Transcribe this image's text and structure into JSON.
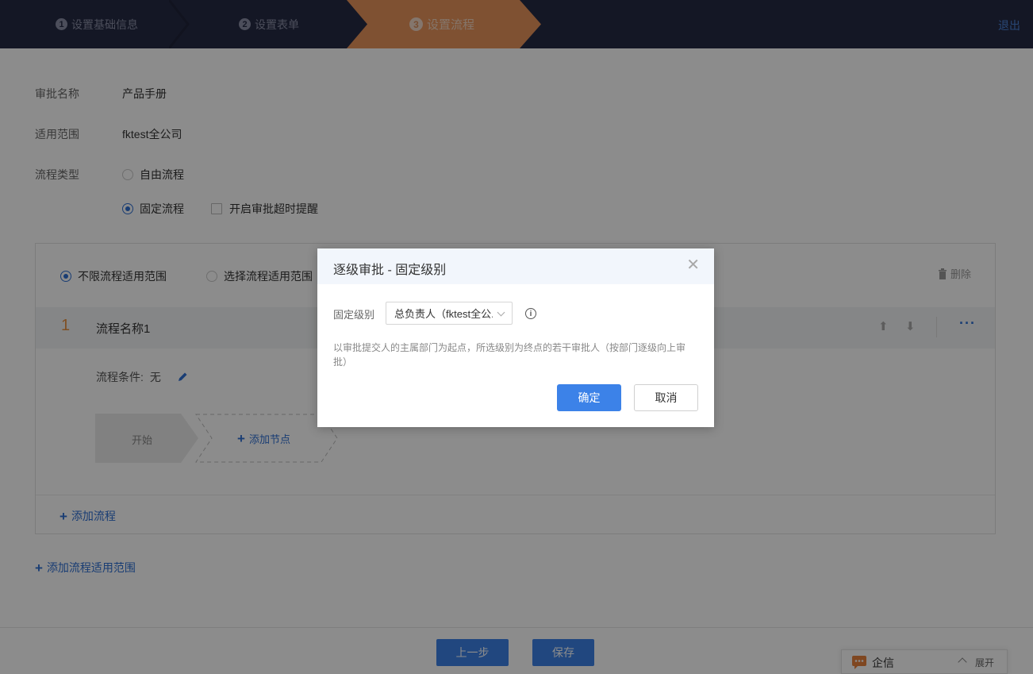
{
  "header": {
    "steps": [
      {
        "num": "1",
        "label": "设置基础信息"
      },
      {
        "num": "2",
        "label": "设置表单"
      },
      {
        "num": "3",
        "label": "设置流程"
      }
    ],
    "logout": "退出"
  },
  "form": {
    "approval_name_label": "审批名称",
    "approval_name_value": "产品手册",
    "scope_label": "适用范围",
    "scope_value": "fktest全公司",
    "type_label": "流程类型",
    "type_free": "自由流程",
    "type_fixed": "固定流程",
    "timeout_reminder": "开启审批超时提醒"
  },
  "card": {
    "scope_unlimited": "不限流程适用范围",
    "scope_select": "选择流程适用范围",
    "delete": "删除",
    "flow_num": "1",
    "flow_name": "流程名称1",
    "condition_label": "流程条件:",
    "condition_value": "无",
    "node_start": "开始",
    "add_node": "添加节点",
    "add_flow": "添加流程"
  },
  "add_scope": "添加流程适用范围",
  "bottom": {
    "prev": "上一步",
    "save": "保存"
  },
  "qixin": {
    "label": "企信",
    "expand": "展开"
  },
  "modal": {
    "title": "逐级审批 - 固定级别",
    "field_label": "固定级别",
    "select_value": "总负责人（fktest全公...",
    "description": "以审批提交人的主属部门为起点，所选级别为终点的若干审批人（按部门逐级向上审批）",
    "ok": "确定",
    "cancel": "取消"
  },
  "colors": {
    "header_bg": "#262b44",
    "active_step": "#e8945c",
    "primary": "#3c82e8",
    "accent_orange": "#e89140"
  }
}
